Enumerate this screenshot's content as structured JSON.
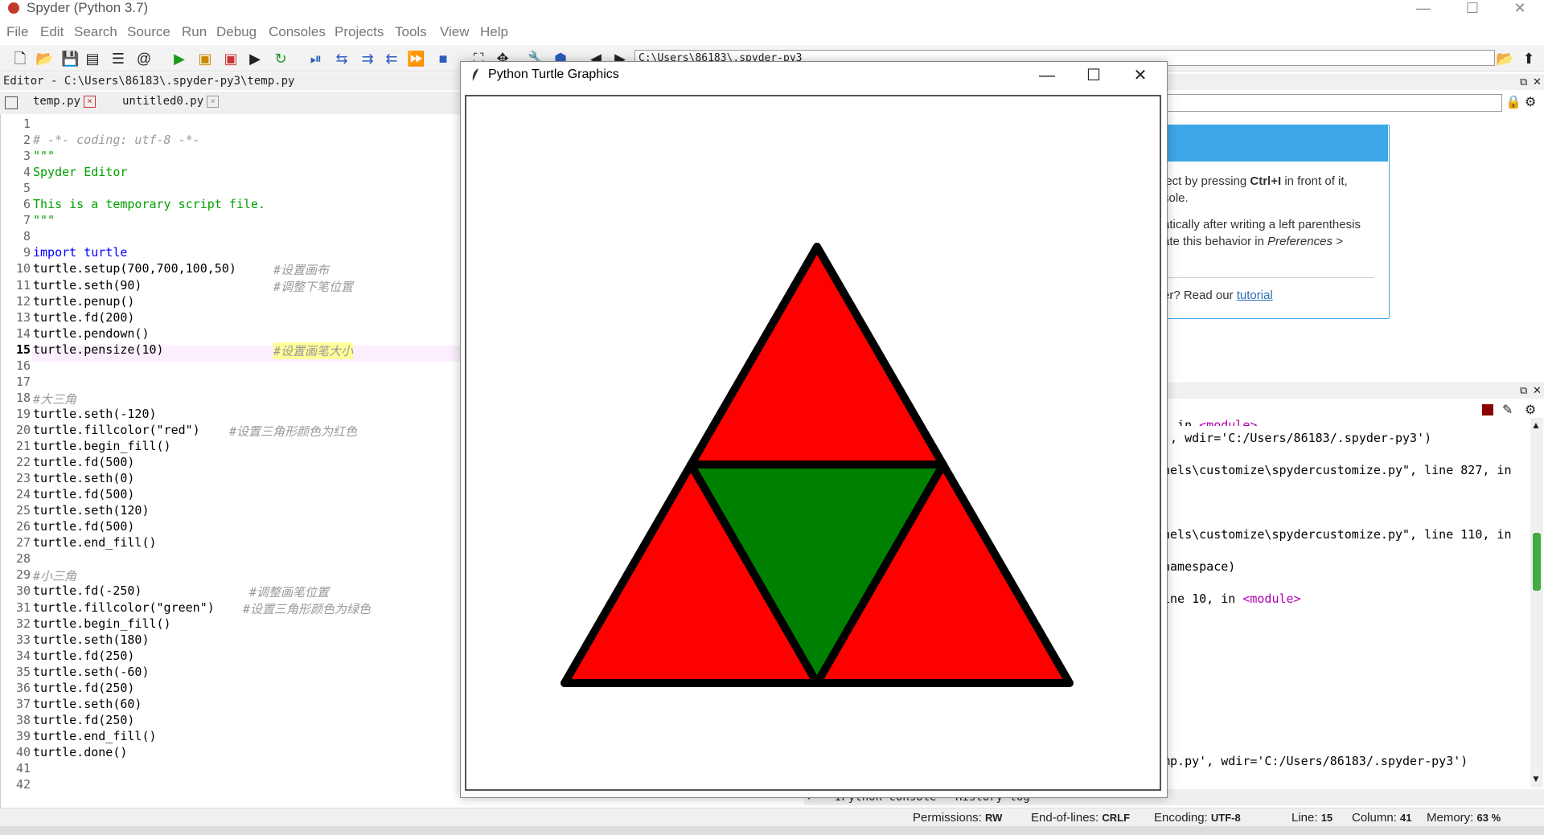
{
  "app": {
    "title": "Spyder (Python 3.7)",
    "menu": [
      "File",
      "Edit",
      "Search",
      "Source",
      "Run",
      "Debug",
      "Consoles",
      "Projects",
      "Tools",
      "View",
      "Help"
    ]
  },
  "toolbar": {
    "path": "C:\\Users\\86183\\.spyder-py3"
  },
  "editor": {
    "header": "Editor - C:\\Users\\86183\\.spyder-py3\\temp.py",
    "tabs": [
      {
        "label": "temp.py",
        "close": "×"
      },
      {
        "label": "untitled0.py",
        "close": "×"
      }
    ],
    "current_line": "15",
    "lines": [
      {
        "n": "1",
        "text": ""
      },
      {
        "n": "2",
        "text": "# -*- coding: utf-8 -*-"
      },
      {
        "n": "3",
        "text": "\"\"\""
      },
      {
        "n": "4",
        "text": "Spyder Editor"
      },
      {
        "n": "5",
        "text": ""
      },
      {
        "n": "6",
        "text": "This is a temporary script file."
      },
      {
        "n": "7",
        "text": "\"\"\""
      },
      {
        "n": "8",
        "text": ""
      },
      {
        "n": "9",
        "text": "import turtle"
      },
      {
        "n": "10",
        "text": "turtle.setup(700,700,100,50)",
        "comment": "#设置画布"
      },
      {
        "n": "11",
        "text": "turtle.seth(90)",
        "comment": "#调整下笔位置"
      },
      {
        "n": "12",
        "text": "turtle.penup()"
      },
      {
        "n": "13",
        "text": "turtle.fd(200)"
      },
      {
        "n": "14",
        "text": "turtle.pendown()"
      },
      {
        "n": "15",
        "text": "turtle.pensize(10)",
        "comment": "#设置画笔大小"
      },
      {
        "n": "16",
        "text": ""
      },
      {
        "n": "17",
        "text": ""
      },
      {
        "n": "18",
        "text": "#大三角"
      },
      {
        "n": "19",
        "text": "turtle.seth(-120)"
      },
      {
        "n": "20",
        "text": "turtle.fillcolor(\"red\")",
        "comment": "#设置三角形颜色为红色"
      },
      {
        "n": "21",
        "text": "turtle.begin_fill()"
      },
      {
        "n": "22",
        "text": "turtle.fd(500)"
      },
      {
        "n": "23",
        "text": "turtle.seth(0)"
      },
      {
        "n": "24",
        "text": "turtle.fd(500)"
      },
      {
        "n": "25",
        "text": "turtle.seth(120)"
      },
      {
        "n": "26",
        "text": "turtle.fd(500)"
      },
      {
        "n": "27",
        "text": "turtle.end_fill()"
      },
      {
        "n": "28",
        "text": ""
      },
      {
        "n": "29",
        "text": "#小三角"
      },
      {
        "n": "30",
        "text": "turtle.fd(-250)",
        "comment": "#调整画笔位置"
      },
      {
        "n": "31",
        "text": "turtle.fillcolor(\"green\")",
        "comment": "#设置三角形颜色为绿色"
      },
      {
        "n": "32",
        "text": "turtle.begin_fill()"
      },
      {
        "n": "33",
        "text": "turtle.seth(180)"
      },
      {
        "n": "34",
        "text": "turtle.fd(250)"
      },
      {
        "n": "35",
        "text": "turtle.seth(-60)"
      },
      {
        "n": "36",
        "text": "turtle.fd(250)"
      },
      {
        "n": "37",
        "text": "turtle.seth(60)"
      },
      {
        "n": "38",
        "text": "turtle.fd(250)"
      },
      {
        "n": "39",
        "text": "turtle.end_fill()"
      },
      {
        "n": "40",
        "text": "turtle.done()"
      },
      {
        "n": "41",
        "text": ""
      },
      {
        "n": "42",
        "text": ""
      }
    ]
  },
  "help": {
    "line1_pre": "ject by pressing ",
    "line1_bold": "Ctrl+I",
    "line1_post": " in front of it,",
    "line2": "sole.",
    "line3": "atically after writing a left parenthesis",
    "line4_pre": "ate this behavior in ",
    "line4_italic": "Preferences >",
    "line5_pre": "er? Read our ",
    "line5_link": "tutorial"
  },
  "console": {
    "lines": [
      {
        "text": ", in ",
        "mag": "<module>"
      },
      {
        "text": "', wdir='C:/Users/86183/.spyder-py3')"
      },
      {
        "text": "nels\\customize\\spydercustomize.py\", line 827, in"
      },
      {
        "text": "nels\\customize\\spydercustomize.py\", line 110, in"
      },
      {
        "text": "namespace)"
      },
      {
        "text": "ine 10, in ",
        "mag": "<module>"
      },
      {
        "text": "mp.py', wdir='C:/Users/86183/.spyder-py3')"
      }
    ],
    "tabs": [
      "IPython console",
      "History log"
    ]
  },
  "status": {
    "permissions_label": "Permissions:",
    "permissions": "RW",
    "eol_label": "End-of-lines:",
    "eol": "CRLF",
    "encoding_label": "Encoding:",
    "encoding": "UTF-8",
    "line_label": "Line:",
    "line": "15",
    "column_label": "Column:",
    "column": "41",
    "memory_label": "Memory:",
    "memory": "63 %"
  },
  "turtle_window": {
    "title": "Python Turtle Graphics",
    "big_triangle_fill": "#ff0000",
    "small_triangle_fill": "#008000",
    "stroke": "#000000"
  }
}
